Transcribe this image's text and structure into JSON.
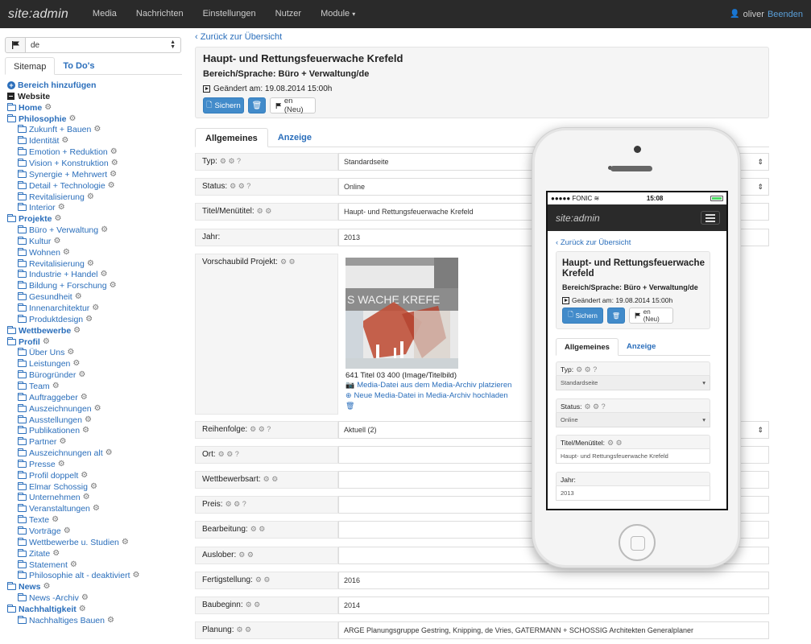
{
  "navbar": {
    "brand": "site:admin",
    "items": [
      "Media",
      "Nachrichten",
      "Einstellungen",
      "Nutzer",
      "Module"
    ],
    "user": "oliver",
    "logout": "Beenden"
  },
  "sidebar": {
    "language": "de",
    "tabs": [
      "Sitemap",
      "To Do's"
    ],
    "tree": [
      {
        "label": "Bereich hinzufügen",
        "level": 0,
        "icon": "plus-circle-icon",
        "gear": false
      },
      {
        "label": "Website",
        "level": 0,
        "icon": "minus-square-icon",
        "gear": false,
        "dark": true
      },
      {
        "label": "Home",
        "level": 0,
        "icon": "folder-icon",
        "gear": true
      },
      {
        "label": "Philosophie",
        "level": 0,
        "icon": "folder-icon",
        "gear": true
      },
      {
        "label": "Zukunft + Bauen",
        "level": 1,
        "icon": "folder-icon",
        "gear": true
      },
      {
        "label": "Identität",
        "level": 1,
        "icon": "folder-icon",
        "gear": true
      },
      {
        "label": "Emotion + Reduktion",
        "level": 1,
        "icon": "folder-icon",
        "gear": true
      },
      {
        "label": "Vision + Konstruktion",
        "level": 1,
        "icon": "folder-icon",
        "gear": true
      },
      {
        "label": "Synergie + Mehrwert",
        "level": 1,
        "icon": "folder-icon",
        "gear": true
      },
      {
        "label": "Detail + Technologie",
        "level": 1,
        "icon": "folder-icon",
        "gear": true
      },
      {
        "label": "Revitalisierung",
        "level": 1,
        "icon": "folder-icon",
        "gear": true
      },
      {
        "label": "Interior",
        "level": 1,
        "icon": "folder-icon",
        "gear": true
      },
      {
        "label": "Projekte",
        "level": 0,
        "icon": "folder-icon",
        "gear": true
      },
      {
        "label": "Büro + Verwaltung",
        "level": 1,
        "icon": "folder-icon",
        "gear": true
      },
      {
        "label": "Kultur",
        "level": 1,
        "icon": "folder-icon",
        "gear": true
      },
      {
        "label": "Wohnen",
        "level": 1,
        "icon": "folder-icon",
        "gear": true
      },
      {
        "label": "Revitalisierung",
        "level": 1,
        "icon": "folder-icon",
        "gear": true
      },
      {
        "label": "Industrie + Handel",
        "level": 1,
        "icon": "folder-icon",
        "gear": true
      },
      {
        "label": "Bildung + Forschung",
        "level": 1,
        "icon": "folder-icon",
        "gear": true
      },
      {
        "label": "Gesundheit",
        "level": 1,
        "icon": "folder-icon",
        "gear": true
      },
      {
        "label": "Innenarchitektur",
        "level": 1,
        "icon": "folder-icon",
        "gear": true
      },
      {
        "label": "Produktdesign",
        "level": 1,
        "icon": "folder-icon",
        "gear": true
      },
      {
        "label": "Wettbewerbe",
        "level": 0,
        "icon": "folder-icon",
        "gear": true
      },
      {
        "label": "Profil",
        "level": 0,
        "icon": "folder-icon",
        "gear": true
      },
      {
        "label": "Über Uns",
        "level": 1,
        "icon": "folder-icon",
        "gear": true
      },
      {
        "label": "Leistungen",
        "level": 1,
        "icon": "folder-icon",
        "gear": true
      },
      {
        "label": "Bürogründer",
        "level": 1,
        "icon": "folder-icon",
        "gear": true
      },
      {
        "label": "Team",
        "level": 1,
        "icon": "folder-icon",
        "gear": true
      },
      {
        "label": "Auftraggeber",
        "level": 1,
        "icon": "folder-icon",
        "gear": true
      },
      {
        "label": "Auszeichnungen",
        "level": 1,
        "icon": "folder-icon",
        "gear": true
      },
      {
        "label": "Ausstellungen",
        "level": 1,
        "icon": "folder-icon",
        "gear": true
      },
      {
        "label": "Publikationen",
        "level": 1,
        "icon": "folder-icon",
        "gear": true
      },
      {
        "label": "Partner",
        "level": 1,
        "icon": "folder-icon",
        "gear": true
      },
      {
        "label": "Auszeichnungen alt",
        "level": 1,
        "icon": "folder-icon",
        "gear": true
      },
      {
        "label": "Presse",
        "level": 1,
        "icon": "folder-icon",
        "gear": true
      },
      {
        "label": "Profil doppelt",
        "level": 1,
        "icon": "folder-icon",
        "gear": true
      },
      {
        "label": "Elmar Schossig",
        "level": 1,
        "icon": "folder-icon",
        "gear": true
      },
      {
        "label": "Unternehmen",
        "level": 1,
        "icon": "folder-icon",
        "gear": true
      },
      {
        "label": "Veranstaltungen",
        "level": 1,
        "icon": "folder-icon",
        "gear": true
      },
      {
        "label": "Texte",
        "level": 1,
        "icon": "folder-icon",
        "gear": true
      },
      {
        "label": "Vorträge",
        "level": 1,
        "icon": "folder-icon",
        "gear": true
      },
      {
        "label": "Wettbewerbe u. Studien",
        "level": 1,
        "icon": "folder-icon",
        "gear": true
      },
      {
        "label": "Zitate",
        "level": 1,
        "icon": "folder-icon",
        "gear": true
      },
      {
        "label": "Statement",
        "level": 1,
        "icon": "folder-icon",
        "gear": true
      },
      {
        "label": "Philosophie alt - deaktiviert",
        "level": 1,
        "icon": "folder-icon",
        "gear": true
      },
      {
        "label": "News",
        "level": 0,
        "icon": "folder-icon",
        "gear": true
      },
      {
        "label": "News -Archiv",
        "level": 1,
        "icon": "folder-icon",
        "gear": true
      },
      {
        "label": "Nachhaltigkeit",
        "level": 0,
        "icon": "folder-icon",
        "gear": true
      },
      {
        "label": "Nachhaltiges Bauen",
        "level": 1,
        "icon": "folder-icon",
        "gear": true
      }
    ]
  },
  "main": {
    "back_link": "Zurück zur Übersicht",
    "title": "Haupt- und Rettungsfeuerwache Krefeld",
    "subtitle": "Bereich/Sprache: Büro + Verwaltung/de",
    "changed": "Geändert am: 19.08.2014 15:00h",
    "save_label": "Sichern",
    "lang_new_label": "en (Neu)",
    "tabs": [
      "Allgemeines",
      "Anzeige"
    ],
    "fields": [
      {
        "label": "Typ:",
        "value": "Standardseite",
        "select": true,
        "icons": "⚙ ⚙ ?"
      },
      {
        "label": "Status:",
        "value": "Online",
        "select": true,
        "icons": "⚙ ⚙ ?"
      },
      {
        "label": "Titel/Menütitel:",
        "value": "Haupt- und Rettungsfeuerwache Krefeld",
        "select": false,
        "icons": "⚙ ⚙"
      },
      {
        "label": "Jahr:",
        "value": "2013",
        "select": false,
        "icons": ""
      }
    ],
    "preview": {
      "label": "Vorschaubild Projekt:",
      "icons": "⚙ ⚙",
      "image_text": "S WACHE KREFE",
      "caption": "641 Titel 03 400 (Image/Titelbild)",
      "link_place": "Media-Datei aus dem Media-Archiv platzieren",
      "link_upload": "Neue Media-Datei in Media-Archiv hochladen"
    },
    "fields2": [
      {
        "label": "Reihenfolge:",
        "value": "Aktuell (2)",
        "select": true,
        "icons": "⚙ ⚙ ?"
      },
      {
        "label": "Ort:",
        "value": "",
        "select": false,
        "icons": "⚙ ⚙ ?"
      },
      {
        "label": "Wettbewerbsart:",
        "value": "",
        "select": false,
        "icons": "⚙ ⚙"
      },
      {
        "label": "Preis:",
        "value": "",
        "select": false,
        "icons": "⚙ ⚙ ?"
      },
      {
        "label": "Bearbeitung:",
        "value": "",
        "select": false,
        "icons": "⚙ ⚙"
      },
      {
        "label": "Auslober:",
        "value": "",
        "select": false,
        "icons": "⚙ ⚙"
      },
      {
        "label": "Fertigstellung:",
        "value": "2016",
        "select": false,
        "icons": "⚙ ⚙"
      },
      {
        "label": "Baubeginn:",
        "value": "2014",
        "select": false,
        "icons": "⚙ ⚙"
      },
      {
        "label": "Planung:",
        "value": "ARGE Planungsgruppe Gestring, Knipping, de Vries,  GATERMANN + SCHOSSIG Architekten Generalplaner",
        "select": false,
        "icons": "⚙ ⚙"
      }
    ]
  },
  "phone": {
    "carrier": "●●●●● FONIC",
    "time": "15:08",
    "brand": "site:admin",
    "back_link": "Zurück zur Übersicht",
    "title": "Haupt- und Rettungsfeuerwache Krefeld",
    "subtitle": "Bereich/Sprache: Büro + Verwaltung/de",
    "changed": "Geändert am: 19.08.2014 15:00h",
    "save_label": "Sichern",
    "lang_new_label": "en (Neu)",
    "tabs": [
      "Allgemeines",
      "Anzeige"
    ],
    "fields": [
      {
        "label": "Typ:",
        "value": "Standardseite",
        "select": true,
        "icons": "⚙ ⚙ ?"
      },
      {
        "label": "Status:",
        "value": "Online",
        "select": true,
        "icons": "⚙ ⚙ ?"
      },
      {
        "label": "Titel/Menütitel:",
        "value": "Haupt- und Rettungsfeuerwache Krefeld",
        "select": false,
        "icons": "⚙ ⚙"
      },
      {
        "label": "Jahr:",
        "value": "2013",
        "select": false,
        "icons": ""
      }
    ]
  }
}
